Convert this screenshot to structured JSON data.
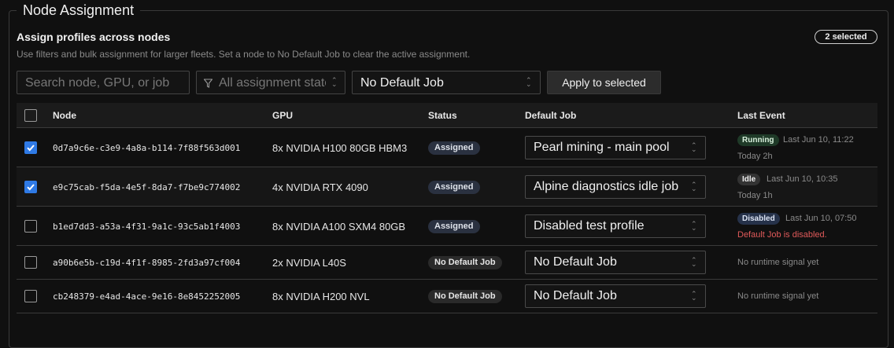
{
  "panel": {
    "legend": "Node Assignment",
    "heading": "Assign profiles across nodes",
    "subtext": "Use filters and bulk assignment for larger fleets. Set a node to No Default Job to clear the active assignment.",
    "selected_badge": "2 selected"
  },
  "toolbar": {
    "search_placeholder": "Search node, GPU, or job",
    "filter_value": "All assignment states",
    "bulk_job_value": "No Default Job",
    "apply_label": "Apply to selected"
  },
  "table": {
    "headers": {
      "node": "Node",
      "gpu": "GPU",
      "status": "Status",
      "default_job": "Default Job",
      "last_event": "Last Event"
    },
    "rows": [
      {
        "checked": true,
        "node": "0d7a9c6e-c3e9-4a8a-b114-7f88f563d001",
        "gpu": "8x NVIDIA H100 80GB HBM3",
        "status": "Assigned",
        "default_job": "Pearl mining - main pool",
        "event_badge": "Running",
        "event_time": "Last Jun 10, 11:22",
        "event_sub": "Today 2h"
      },
      {
        "checked": true,
        "node": "e9c75cab-f5da-4e5f-8da7-f7be9c774002",
        "gpu": "4x NVIDIA RTX 4090",
        "status": "Assigned",
        "default_job": "Alpine diagnostics idle job",
        "event_badge": "Idle",
        "event_time": "Last Jun 10, 10:35",
        "event_sub": "Today 1h"
      },
      {
        "checked": false,
        "node": "b1ed7dd3-a53a-4f31-9a1c-93c5ab1f4003",
        "gpu": "8x NVIDIA A100 SXM4 80GB",
        "status": "Assigned",
        "default_job": "Disabled test profile",
        "event_badge": "Disabled",
        "event_time": "Last Jun 10, 07:50",
        "event_sub": "Default Job is disabled."
      },
      {
        "checked": false,
        "node": "a90b6e5b-c19d-4f1f-8985-2fd3a97cf004",
        "gpu": "2x NVIDIA L40S",
        "status": "No Default Job",
        "default_job": "No Default Job",
        "event_none": "No runtime signal yet"
      },
      {
        "checked": false,
        "node": "cb248379-e4ad-4ace-9e16-8e8452252005",
        "gpu": "8x NVIDIA H200 NVL",
        "status": "No Default Job",
        "default_job": "No Default Job",
        "event_none": "No runtime signal yet"
      }
    ]
  },
  "colors": {
    "accent": "#2f7ae5",
    "error": "#e05a5a",
    "running": "#1f3a28"
  }
}
